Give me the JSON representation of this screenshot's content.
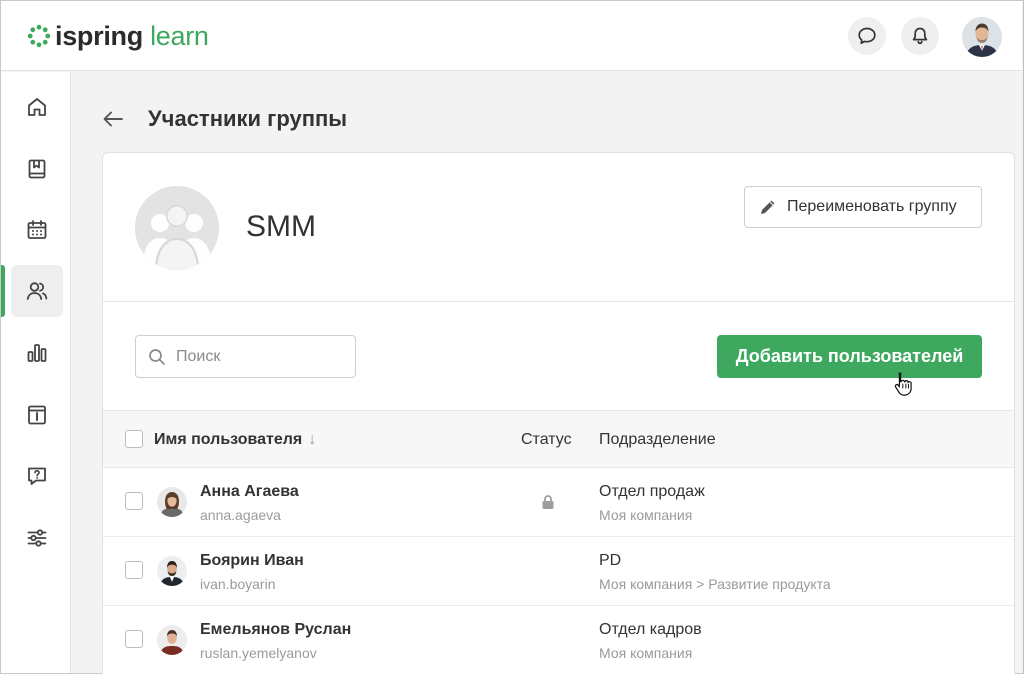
{
  "app": {
    "logo_part1": "ispring",
    "logo_part2": "learn",
    "accent_color": "#3fa85f"
  },
  "header": {
    "icons": [
      "chat-icon",
      "bell-icon",
      "user-avatar"
    ]
  },
  "sidebar": {
    "items": [
      {
        "name": "home-icon",
        "active": false
      },
      {
        "name": "courses-icon",
        "active": false
      },
      {
        "name": "calendar-icon",
        "active": false
      },
      {
        "name": "users-icon",
        "active": true
      },
      {
        "name": "reports-icon",
        "active": false
      },
      {
        "name": "info-icon",
        "active": false
      },
      {
        "name": "help-icon",
        "active": false
      },
      {
        "name": "settings-icon",
        "active": false
      }
    ]
  },
  "page": {
    "title": "Участники группы"
  },
  "group": {
    "name": "SMM",
    "rename_label": "Переименовать группу"
  },
  "toolbar": {
    "search_placeholder": "Поиск",
    "add_label": "Добавить пользователей"
  },
  "table": {
    "columns": {
      "name": "Имя пользователя",
      "status": "Статус",
      "department": "Подразделение"
    },
    "rows": [
      {
        "name": "Анна Агаева",
        "login": "anna.agaeva",
        "locked": true,
        "department": "Отдел продаж",
        "path": "Моя компания"
      },
      {
        "name": "Боярин Иван",
        "login": "ivan.boyarin",
        "locked": false,
        "department": "PD",
        "path": "Моя компания > Развитие продукта"
      },
      {
        "name": "Емельянов Руслан",
        "login": "ruslan.yemelyanov",
        "locked": false,
        "department": "Отдел кадров",
        "path": "Моя компания"
      }
    ]
  }
}
